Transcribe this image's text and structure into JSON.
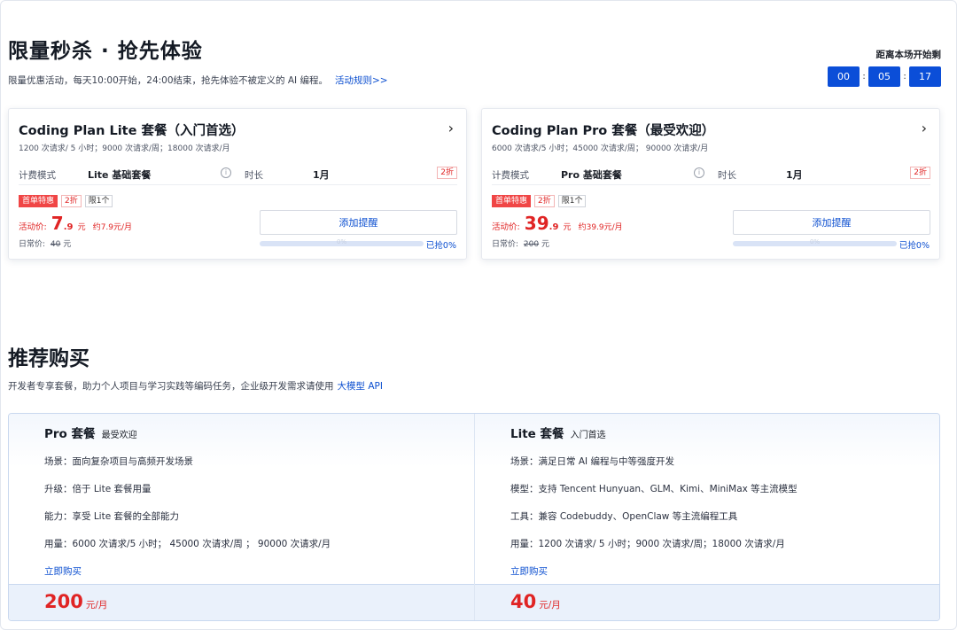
{
  "flash_sale": {
    "title": "限量秒杀 · 抢先体验",
    "subtitle": "限量优惠活动，每天10:00开始，24:00结束，抢先体验不被定义的 AI 编程。",
    "rules_link": "活动规则>>",
    "countdown": {
      "label": "距离本场开始剩",
      "hours": "00",
      "minutes": "05",
      "seconds": "17",
      "separator": ":"
    },
    "cards": [
      {
        "title": "Coding Plan Lite 套餐（入门首选）",
        "quota": "1200 次请求/ 5 小时；9000 次请求/周；18000 次请求/月",
        "billing_label": "计费模式",
        "billing_value": "Lite 基础套餐",
        "duration_label": "时长",
        "duration_value": "1月",
        "discount_tag": "2折",
        "tags": [
          "首单特惠",
          "2折",
          "限1个"
        ],
        "promo_label": "活动价:",
        "promo_int": "7",
        "promo_dec": ".9",
        "promo_unit": "元",
        "promo_per": "约7.9元/月",
        "regular_label": "日常价:",
        "regular_price": "40",
        "regular_unit": "元",
        "remind_button": "添加提醒",
        "progress_label": "0%",
        "progress": 0,
        "sold_text": "已抢0%"
      },
      {
        "title": "Coding Plan Pro 套餐（最受欢迎）",
        "quota": "6000 次请求/5 小时；45000 次请求/周； 90000 次请求/月",
        "billing_label": "计费模式",
        "billing_value": "Pro 基础套餐",
        "duration_label": "时长",
        "duration_value": "1月",
        "discount_tag": "2折",
        "tags": [
          "首单特惠",
          "2折",
          "限1个"
        ],
        "promo_label": "活动价:",
        "promo_int": "39",
        "promo_dec": ".9",
        "promo_unit": "元",
        "promo_per": "约39.9元/月",
        "regular_label": "日常价:",
        "regular_price": "200",
        "regular_unit": "元",
        "remind_button": "添加提醒",
        "progress_label": "0%",
        "progress": 0,
        "sold_text": "已抢0%"
      }
    ]
  },
  "recommend": {
    "title": "推荐购买",
    "subtitle": "开发者专享套餐，助力个人项目与学习实践等编码任务，企业级开发需求请使用",
    "api_link": "大模型 API",
    "plans": [
      {
        "name": "Pro 套餐",
        "badge": "最受欢迎",
        "features": [
          "场景：面向复杂项目与高频开发场景",
          "升级：倍于 Lite 套餐用量",
          "能力：享受 Lite 套餐的全部能力",
          "用量：6000 次请求/5 小时； 45000 次请求/周 ； 90000 次请求/月"
        ],
        "buy_link": "立即购买",
        "price": "200",
        "unit": "元/月"
      },
      {
        "name": "Lite 套餐",
        "badge": "入门首选",
        "features": [
          "场景：满足日常 AI 编程与中等强度开发",
          "模型：支持 Tencent Hunyuan、GLM、Kimi、MiniMax 等主流模型",
          "工具：兼容 Codebuddy、OpenClaw 等主流编程工具",
          "用量：1200 次请求/ 5 小时；9000 次请求/周；18000 次请求/月"
        ],
        "buy_link": "立即购买",
        "price": "40",
        "unit": "元/月"
      }
    ]
  },
  "colors": {
    "accent": "#0b4ed8",
    "price_red": "#e02424",
    "link_blue": "#0c4fd0"
  }
}
